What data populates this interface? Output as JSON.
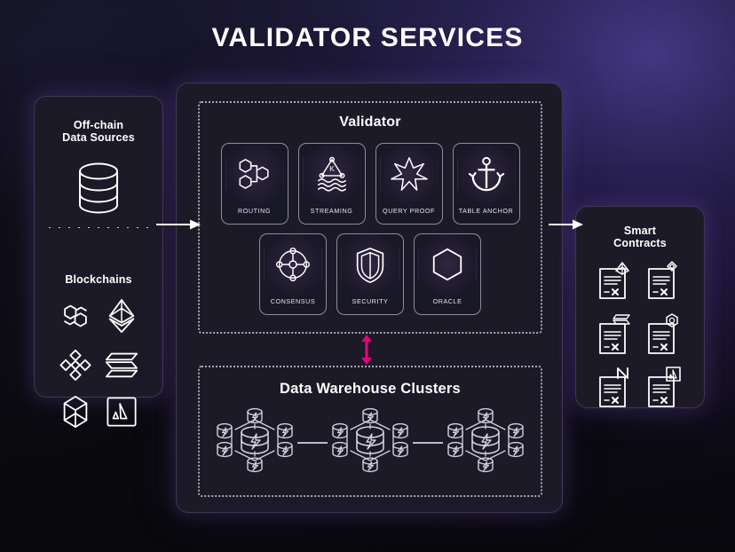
{
  "title": "VALIDATOR SERVICES",
  "colors": {
    "background_dark": "#0b0b10",
    "panel": "#1b1a26",
    "panel_glow": "#7850b4",
    "accent_magenta": "#e6007e",
    "stroke_white": "#ffffff",
    "label_text": "#e6e4ef"
  },
  "left_panel": {
    "offchain_heading_line1": "Off-chain",
    "offchain_heading_line2": "Data Sources",
    "database_icon": "database-cylinder-icon",
    "blockchains_heading": "Blockchains",
    "chains": [
      {
        "name": "polygon",
        "icon": "polygon-logo-icon"
      },
      {
        "name": "ethereum",
        "icon": "ethereum-logo-icon"
      },
      {
        "name": "binance",
        "icon": "binance-logo-icon"
      },
      {
        "name": "solana",
        "icon": "solana-logo-icon"
      },
      {
        "name": "fantom",
        "icon": "fantom-logo-icon"
      },
      {
        "name": "avalanche",
        "icon": "avalanche-logo-icon"
      }
    ]
  },
  "center_panel": {
    "validator": {
      "title": "Validator",
      "services_top": [
        {
          "label": "ROUTING",
          "icon": "routing-hexnodes-icon"
        },
        {
          "label": "STREAMING",
          "icon": "streaming-waves-icon"
        },
        {
          "label": "QUERY PROOF",
          "icon": "query-proof-star-icon"
        },
        {
          "label": "TABLE ANCHOR",
          "icon": "table-anchor-icon"
        }
      ],
      "services_bottom": [
        {
          "label": "CONSENSUS",
          "icon": "consensus-network-icon"
        },
        {
          "label": "SECURITY",
          "icon": "security-shield-icon"
        },
        {
          "label": "ORACLE",
          "icon": "oracle-hexagon-icon"
        }
      ]
    },
    "warehouse": {
      "title": "Data Warehouse Clusters",
      "clusters": [
        {
          "name": "cluster-1",
          "icon": "warehouse-cluster-icon"
        },
        {
          "name": "cluster-2",
          "icon": "warehouse-cluster-icon"
        },
        {
          "name": "cluster-3",
          "icon": "warehouse-cluster-icon"
        }
      ],
      "links": 2
    }
  },
  "right_panel": {
    "heading_line1": "Smart",
    "heading_line2": "Contracts",
    "contracts": [
      {
        "chain": "ethereum",
        "icon": "contract-doc-ethereum-icon"
      },
      {
        "chain": "binance",
        "icon": "contract-doc-binance-icon"
      },
      {
        "chain": "solana",
        "icon": "contract-doc-solana-icon"
      },
      {
        "chain": "polygon",
        "icon": "contract-doc-polygon-icon"
      },
      {
        "chain": "near",
        "icon": "contract-doc-near-icon"
      },
      {
        "chain": "avalanche",
        "icon": "contract-doc-avalanche-icon"
      }
    ]
  },
  "arrows": {
    "into_validator": "arrow-right-icon",
    "out_to_contracts": "arrow-right-icon",
    "validator_warehouse_sync": "arrow-double-vertical-icon"
  }
}
